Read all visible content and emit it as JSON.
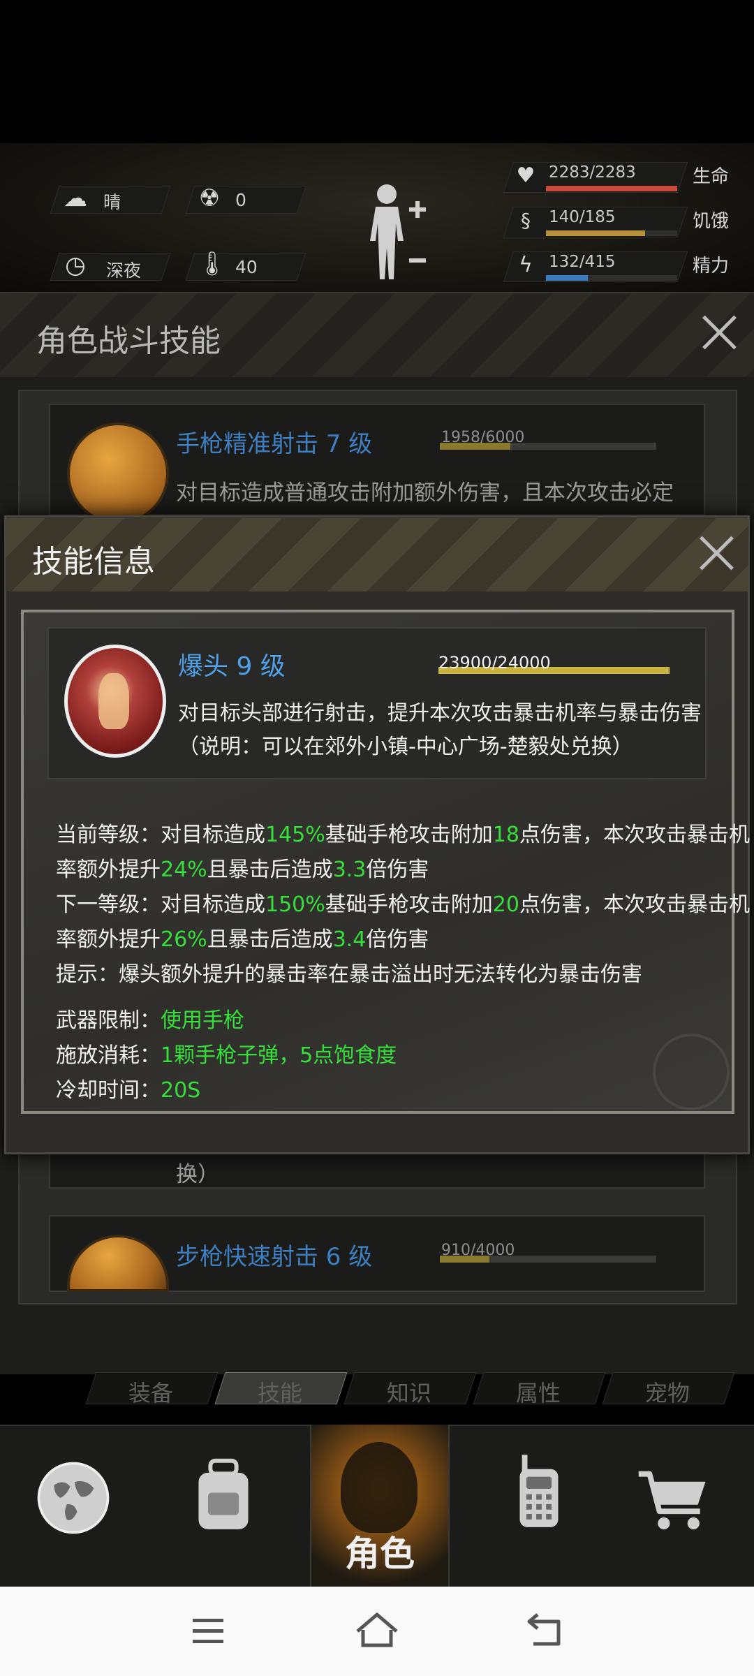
{
  "hud": {
    "weather": "晴",
    "radiation": "0",
    "time_of_day": "深夜",
    "temperature": "40",
    "vitals": [
      {
        "label": "生命",
        "value": "2283/2283",
        "fill": 1.0,
        "color": "#c84a3a"
      },
      {
        "label": "饥饿",
        "value": "140/185",
        "fill": 0.757,
        "color": "#b8923a"
      },
      {
        "label": "精力",
        "value": "132/415",
        "fill": 0.318,
        "color": "#3a7ac0"
      }
    ]
  },
  "skills_panel": {
    "title": "角色战斗技能",
    "items": [
      {
        "name": "手枪精准射击 7 级",
        "xp": "1958/6000",
        "xp_fill": 0.326,
        "desc": "对目标造成普通攻击附加额外伤害，且本次攻击必定"
      },
      {
        "tail_text": "换）"
      },
      {
        "name": "步枪快速射击 6 级",
        "xp": "910/4000",
        "xp_fill": 0.2275
      }
    ]
  },
  "skill_info": {
    "title": "技能信息",
    "name": "爆头 9 级",
    "xp": "23900/24000",
    "xp_fill": 0.996,
    "desc1": "对目标头部进行射击，提升本次攻击暴击机率与暴击伤害",
    "desc2": "（说明：可以在郊外小镇-中心广场-楚毅处兑换）",
    "current": {
      "p1": "当前等级：对目标造成",
      "v1": "145%",
      "p2": "基础手枪攻击附加",
      "v2": "18",
      "p3": "点伤害，本次攻击暴击机",
      "p4": "率额外提升",
      "v3": "24%",
      "p5": "且暴击后造成",
      "v4": "3.3",
      "p6": "倍伤害"
    },
    "next": {
      "p1": "下一等级：对目标造成",
      "v1": "150%",
      "p2": "基础手枪攻击附加",
      "v2": "20",
      "p3": "点伤害，本次攻击暴击机",
      "p4": "率额外提升",
      "v3": "26%",
      "p5": "且暴击后造成",
      "v4": "3.4",
      "p6": "倍伤害"
    },
    "tip": "提示：爆头额外提升的暴击率在暴击溢出时无法转化为暴击伤害",
    "weapon_label": "武器限制：",
    "weapon_value": "使用手枪",
    "cost_label": "施放消耗：",
    "cost_value": "1颗手枪子弹，5点饱食度",
    "cooldown_label": "冷却时间：",
    "cooldown_value": "20S"
  },
  "sub_tabs": [
    "装备",
    "技能",
    "知识",
    "属性",
    "宠物"
  ],
  "main_nav": {
    "items": [
      "globe-icon",
      "backpack-icon",
      "角色",
      "radio-icon",
      "cart-icon"
    ],
    "role_label": "角色"
  },
  "colors": {
    "accent_blue": "#4ea1ea",
    "highlight_green": "#35e03a",
    "gold_bar": "#c9b43c"
  }
}
